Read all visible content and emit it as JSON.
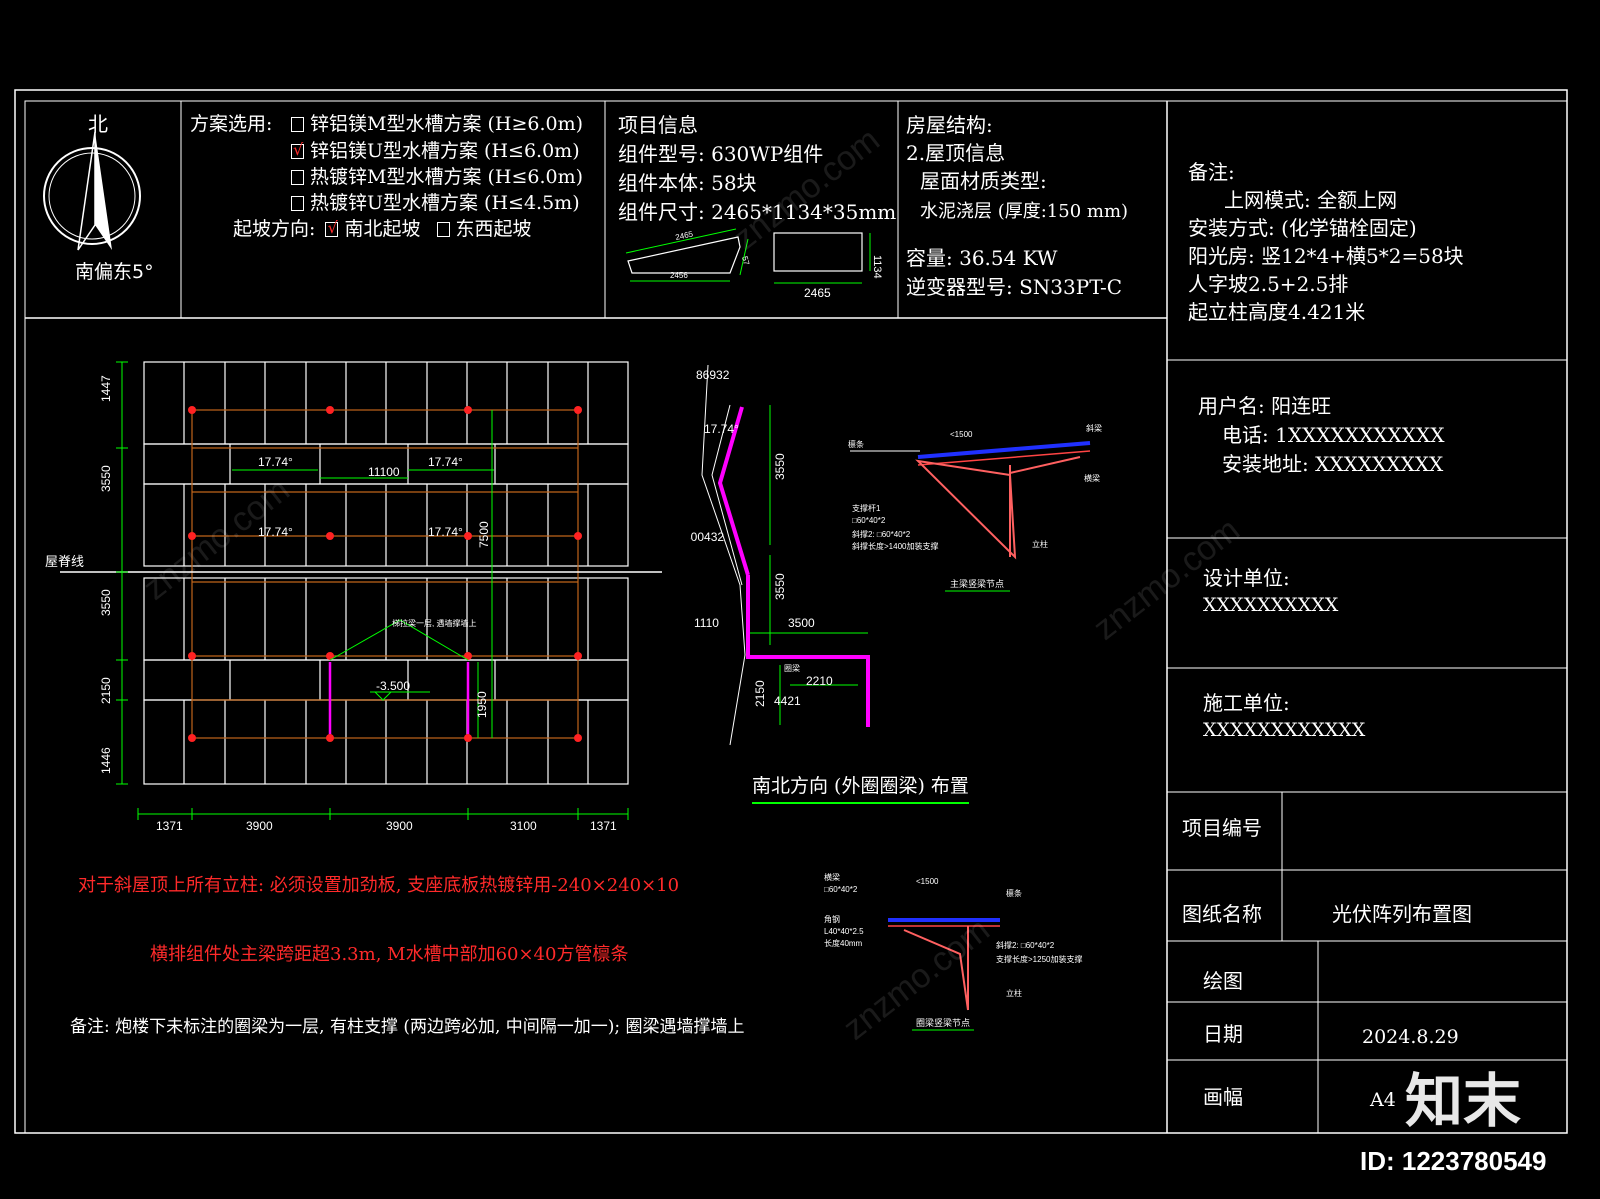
{
  "compass": {
    "north_label": "北",
    "deviation_label": "南偏东5°"
  },
  "scheme": {
    "label": "方案选用:",
    "options": [
      {
        "text": "锌铝镁M型水槽方案 (H≥6.0m)",
        "checked": false
      },
      {
        "text": "锌铝镁U型水槽方案 (H≤6.0m)",
        "checked": true
      },
      {
        "text": "热镀锌M型水槽方案 (H≤6.0m)",
        "checked": false
      },
      {
        "text": "热镀锌U型水槽方案 (H≤4.5m)",
        "checked": false
      }
    ],
    "slope_label": "起坡方向:",
    "slope_ns": "南北起坡",
    "slope_ew": "东西起坡"
  },
  "project": {
    "title": "项目信息",
    "module_model": "组件型号: 630WP组件",
    "module_count": "组件本体: 58块",
    "module_size": "组件尺寸: 2465*1134*35mm",
    "dims": {
      "top": "2465",
      "bottom": "2456",
      "side": "57",
      "height": "1134",
      "width": "2465"
    }
  },
  "house": {
    "title": "房屋结构:",
    "roof_info": "2.屋顶信息",
    "material_label": "屋面材质类型:",
    "material": "水泥浇层 (厚度:150 mm)",
    "capacity": "容量: 36.54 KW",
    "inverter": "逆变器型号: SN33PT-C"
  },
  "notes": {
    "title": "备注:",
    "lines": [
      "上网模式: 全额上网",
      "安装方式: (化学锚栓固定)",
      "阳光房: 竖12*4+横5*2=58块",
      "人字坡2.5+2.5排",
      "起立柱高度4.421米"
    ]
  },
  "user": {
    "name": "用户名: 阳连旺",
    "phone": "电话: 1XXXXXXXXXXX",
    "address": "安装地址: XXXXXXXXX"
  },
  "design_unit": {
    "label": "设计单位:",
    "value": "XXXXXXXXXX"
  },
  "build_unit": {
    "label": "施工单位:",
    "value": "XXXXXXXXXXXX"
  },
  "title_block": {
    "project_no_label": "项目编号",
    "drawing_name_label": "图纸名称",
    "drawing_name": "光伏阵列布置图",
    "drawn_label": "绘图",
    "date_label": "日期",
    "date": "2024.8.29",
    "sheet_label": "画幅",
    "sheet": "A4"
  },
  "plan": {
    "ridge_label": "屋脊线",
    "left_dims": [
      "1447",
      "3550",
      "3550",
      "2150",
      "1446"
    ],
    "bottom_dims": [
      "1371",
      "3900",
      "3900",
      "3100",
      "1371"
    ],
    "angles": [
      "17.74°",
      "17.74°",
      "17.74°",
      "17.74°"
    ],
    "span": "11100",
    "right_dim": "7500",
    "inner_dim": "1950",
    "level": "-3.500",
    "beam_note": "梯拉梁一层, 遇墙撑墙上"
  },
  "section": {
    "title": "南北方向 (外圈圈梁) 布置",
    "dims": [
      "86932",
      "17.74°",
      "3550",
      "800432",
      "3550",
      "1110",
      "3500",
      "2150",
      "4421",
      "2210"
    ],
    "beam_label": "圈梁"
  },
  "warnings": {
    "line1": "对于斜屋顶上所有立柱: 必须设置加劲板, 支座底板热镀锌用-240×240×10",
    "line2": "横排组件处主梁跨距超3.3m, M水槽中部加60×40方管檩条",
    "note": "备注: 炮楼下未标注的圈梁为一层, 有柱支撑 (两边跨必加, 中间隔一加一); 圈梁遇墙撑墙上"
  },
  "details": {
    "top_title": "主梁竖梁节点",
    "bottom_title": "圈梁竖梁节点",
    "top_labels": [
      "檩条",
      "<1500",
      "斜梁",
      "横梁",
      "支撑杆1",
      "□60*40*2",
      "斜撑2: □60*40*2",
      "斜撑长度>1400加装支撑",
      "立柱"
    ],
    "bottom_labels": [
      "横梁",
      "□60*40*2",
      "<1500",
      "檩条",
      "角钢",
      "L40*40*2.5",
      "长度40mm",
      "斜撑2: □60*40*2",
      "支撑长度>1250加装支撑",
      "立柱"
    ]
  },
  "brand": {
    "logo": "知末",
    "id": "ID: 1223780549"
  },
  "colors": {
    "background": "#000000",
    "lines": "#ffffff",
    "warning": "#ff2a2a",
    "dimension": "#00ff00",
    "beam": "#ff00ff",
    "array": "#c0651a"
  }
}
